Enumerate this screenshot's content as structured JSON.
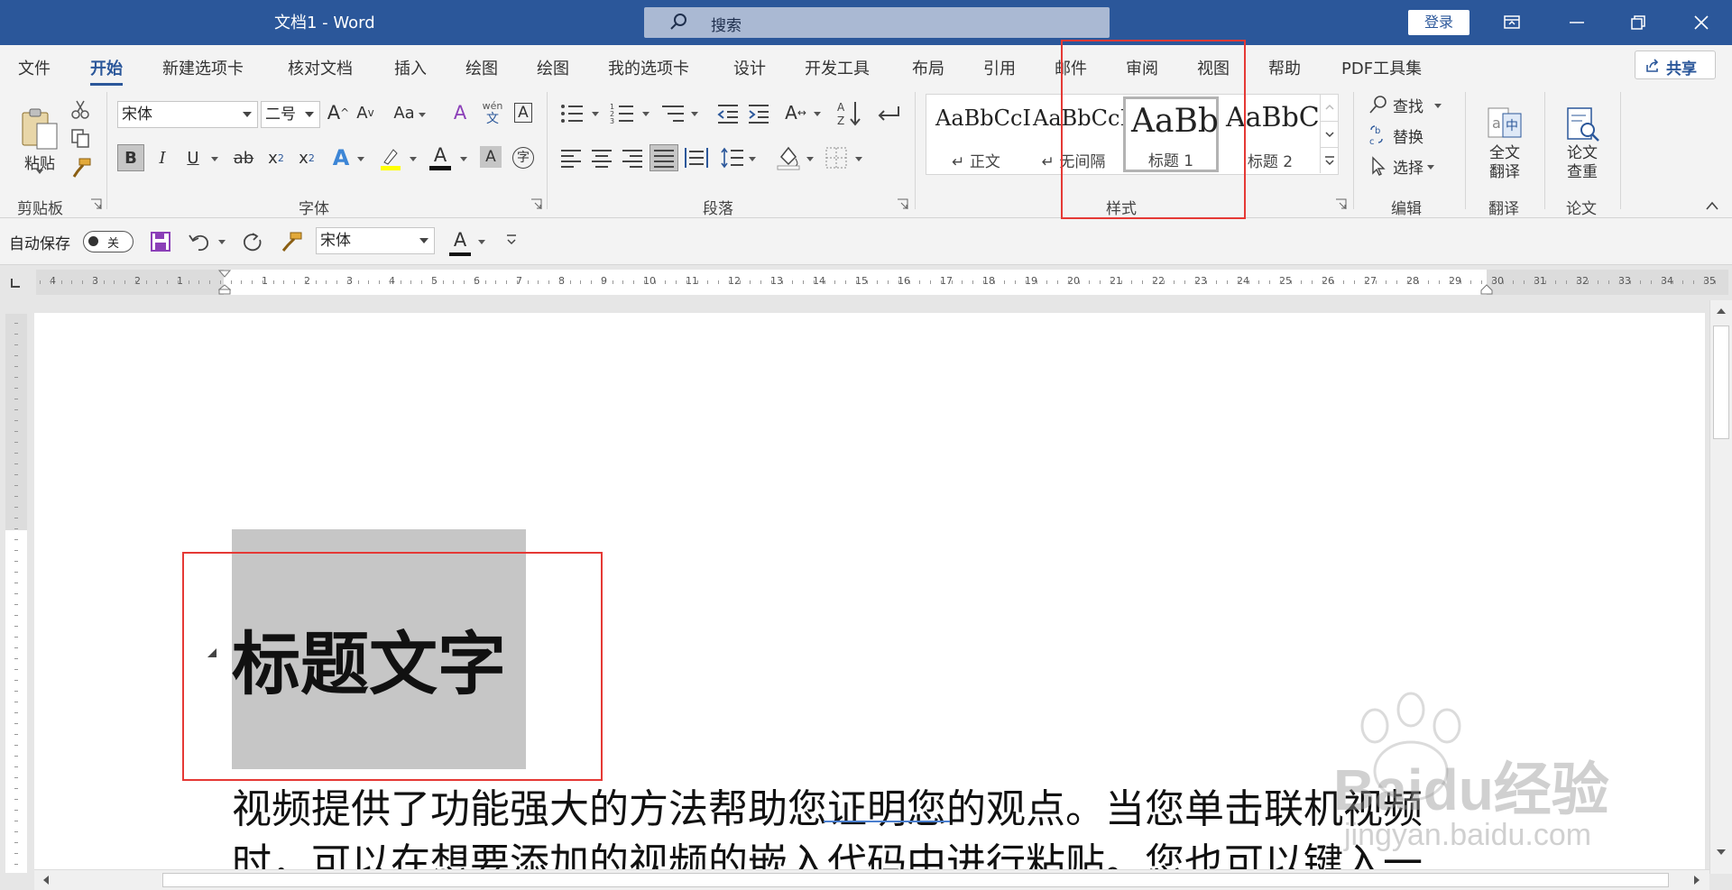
{
  "window": {
    "title": "文档1  -  Word",
    "login": "登录"
  },
  "search": {
    "placeholder": "搜索"
  },
  "tabs": [
    "文件",
    "开始",
    "新建选项卡",
    "核对文档",
    "插入",
    "绘图",
    "绘图",
    "我的选项卡",
    "设计",
    "开发工具",
    "布局",
    "引用",
    "邮件",
    "审阅",
    "视图",
    "帮助",
    "PDF工具集"
  ],
  "active_tab": "开始",
  "share_label": "共享",
  "ribbon": {
    "clipboard": {
      "paste": "粘贴",
      "label": "剪贴板"
    },
    "font": {
      "name": "宋体",
      "size": "二号",
      "case_btn": "Aa",
      "pinyin_top": "wén",
      "pinyin_bottom": "文",
      "label": "字体"
    },
    "paragraph": {
      "label": "段落"
    },
    "styles": {
      "label": "样式",
      "items": [
        {
          "sample": "AaBbCcI",
          "name": "↵ 正文"
        },
        {
          "sample": "AaBbCcI",
          "name": "↵ 无间隔"
        },
        {
          "sample": "AaBb",
          "name": "标题 1"
        },
        {
          "sample": "AaBbC",
          "name": "标题 2"
        }
      ],
      "selected": "标题 1"
    },
    "editing": {
      "find": "查找",
      "replace": "替换",
      "select": "选择",
      "label": "编辑"
    },
    "translate": {
      "line1": "全文",
      "line2": "翻译",
      "label": "翻译"
    },
    "paper": {
      "line1": "论文",
      "line2": "查重",
      "label": "论文"
    }
  },
  "qat": {
    "autosave_label": "自动保存",
    "autosave_state": "关",
    "font": "宋体"
  },
  "ruler": {
    "left_numbers": [
      "4",
      "3",
      "2",
      "1"
    ],
    "right_numbers": [
      "1",
      "2",
      "3",
      "4",
      "5",
      "6",
      "7",
      "8",
      "9",
      "10",
      "11",
      "12",
      "13",
      "14",
      "15",
      "16",
      "17",
      "18",
      "19",
      "20",
      "21",
      "22",
      "23",
      "24",
      "25",
      "26",
      "27",
      "28",
      "29",
      "30",
      "31",
      "32",
      "33",
      "34",
      "35"
    ]
  },
  "document": {
    "heading": "标题文字",
    "paragraph_lines": [
      "视频提供了功能强大的方法帮助您证明您的观点。当您单击联机视频",
      "时，可以在想要添加的视频的嵌入代码中进行粘贴。您也可以键入一"
    ]
  },
  "watermark": {
    "brand": "Baidu经验",
    "url": "jingyan.baidu.com"
  },
  "colors": {
    "title_bar": "#2b579a",
    "highlight_box": "#e53935",
    "selection": "#c6c6c6"
  }
}
